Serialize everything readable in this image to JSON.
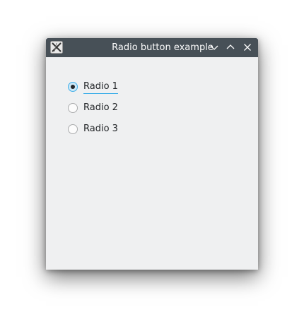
{
  "window": {
    "title": "Radio button example",
    "buttons": {
      "minimize": "chevron-down-icon",
      "maximize": "chevron-up-icon",
      "close": "close-icon"
    }
  },
  "radios": [
    {
      "label": "Radio 1",
      "checked": true
    },
    {
      "label": "Radio 2",
      "checked": false
    },
    {
      "label": "Radio 3",
      "checked": false
    }
  ],
  "colors": {
    "titlebar": "#475057",
    "background": "#eff0f1",
    "accent": "#3daee9",
    "text": "#232629"
  }
}
